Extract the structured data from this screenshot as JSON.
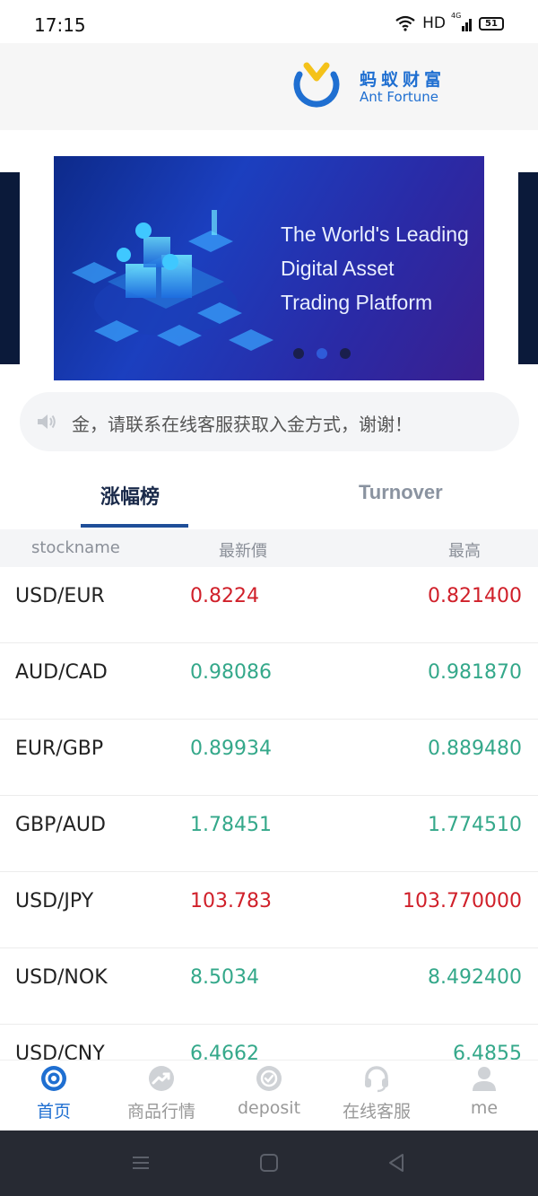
{
  "status": {
    "time": "17:15",
    "network": "HD",
    "signal_label": "4G",
    "battery": "51"
  },
  "brand": {
    "name_cn": "蚂蚁财富",
    "name_en": "Ant Fortune"
  },
  "banner": {
    "lines": [
      "The World's Leading",
      "Digital Asset",
      "Trading Platform"
    ],
    "slide_count": 3,
    "active_slide": 1
  },
  "notice": {
    "text": "金，请联系在线客服获取入金方式，谢谢！"
  },
  "tabs": [
    {
      "label": "涨幅榜",
      "active": true
    },
    {
      "label": "Turnover",
      "active": false
    }
  ],
  "table": {
    "headers": {
      "name": "stockname",
      "last": "最新價",
      "high": "最高"
    },
    "rows": [
      {
        "name": "USD/EUR",
        "last": "0.8224",
        "high": "0.821400",
        "trend": "down"
      },
      {
        "name": "AUD/CAD",
        "last": "0.98086",
        "high": "0.981870",
        "trend": "up"
      },
      {
        "name": "EUR/GBP",
        "last": "0.89934",
        "high": "0.889480",
        "trend": "up"
      },
      {
        "name": "GBP/AUD",
        "last": "1.78451",
        "high": "1.774510",
        "trend": "up"
      },
      {
        "name": "USD/JPY",
        "last": "103.783",
        "high": "103.770000",
        "trend": "down"
      },
      {
        "name": "USD/NOK",
        "last": "8.5034",
        "high": "8.492400",
        "trend": "up"
      },
      {
        "name": "USD/CNY",
        "last": "6.4662",
        "high": "6.4855",
        "trend": "up"
      }
    ]
  },
  "nav": [
    {
      "label": "首页",
      "icon": "home-icon",
      "active": true
    },
    {
      "label": "商品行情",
      "icon": "market-trend-icon",
      "active": false
    },
    {
      "label": "deposit",
      "icon": "deposit-icon",
      "active": false
    },
    {
      "label": "在线客服",
      "icon": "headset-icon",
      "active": false
    },
    {
      "label": "me",
      "icon": "user-icon",
      "active": false
    }
  ],
  "colors": {
    "brand": "#1f6fd1",
    "up": "#34a88a",
    "down": "#d0202a",
    "logo_yellow": "#f4c21a"
  }
}
